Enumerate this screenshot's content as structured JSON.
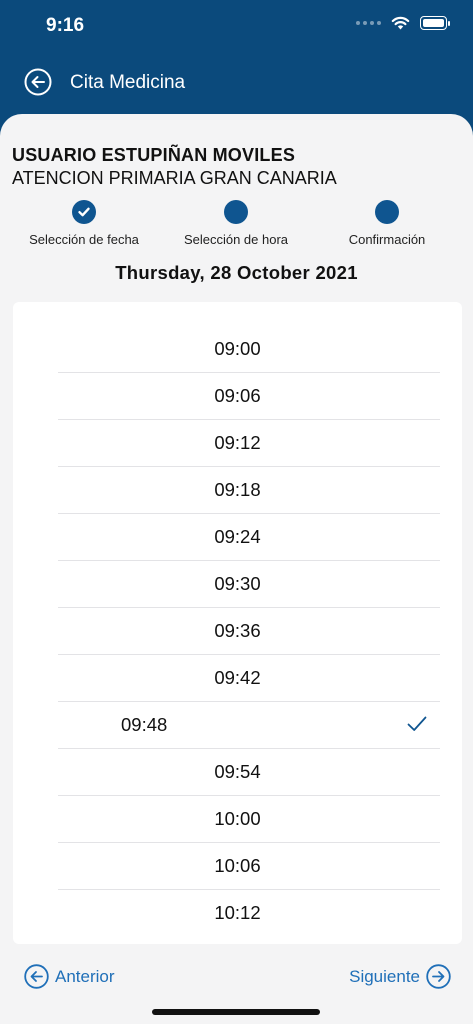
{
  "status_bar": {
    "time": "9:16"
  },
  "header": {
    "title": "Cita Medicina"
  },
  "patient": {
    "name": "USUARIO ESTUPIÑAN MOVILES",
    "center": "ATENCION PRIMARIA GRAN CANARIA"
  },
  "steps": [
    {
      "label": "Selección de fecha",
      "state": "completed"
    },
    {
      "label": "Selección de hora",
      "state": "pending"
    },
    {
      "label": "Confirmación",
      "state": "pending"
    }
  ],
  "date_title": "Thursday, 28 October 2021",
  "times": [
    "09:00",
    "09:06",
    "09:12",
    "09:18",
    "09:24",
    "09:30",
    "09:36",
    "09:42",
    "09:48",
    "09:54",
    "10:00",
    "10:06",
    "10:12"
  ],
  "selected_time": "09:48",
  "navigation": {
    "prev_label": "Anterior",
    "next_label": "Siguiente"
  },
  "colors": {
    "primary": "#0b4a7c",
    "step": "#0f5590",
    "link": "#1f6fb8"
  }
}
